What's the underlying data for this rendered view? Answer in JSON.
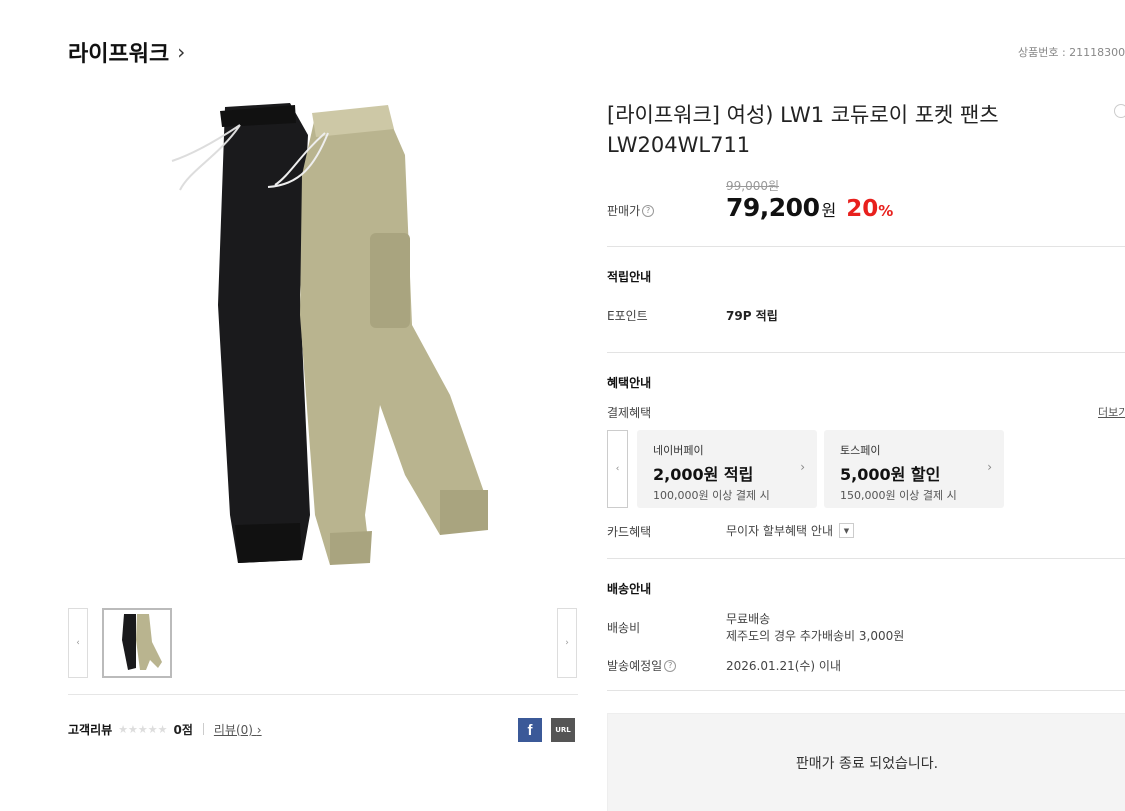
{
  "header": {
    "brand": "라이프워크",
    "brand_chevron": "›",
    "product_no": "상품번호 : 21118300"
  },
  "gallery": {
    "prev_label": "‹",
    "next_label": "›",
    "pants_colors": [
      "#1a1a1c",
      "#b9b48f"
    ]
  },
  "product": {
    "title": "[라이프워크] 여성) LW1 코듀로이 포켓 팬츠 LW204WL711",
    "original_price": "99,000원",
    "price_label": "판매가",
    "price": "79,200",
    "price_unit": "원",
    "discount": "20",
    "discount_unit": "%",
    "discount_color": "#e8201d"
  },
  "points": {
    "section_title": "적립안내",
    "label": "E포인트",
    "value": "79P 적립"
  },
  "benefits": {
    "section_title": "혜택안내",
    "payment_label": "결제혜택",
    "more_label": "더보기",
    "prev_label": "‹",
    "cards": [
      {
        "name": "네이버페이",
        "benefit": "2,000원 적립",
        "condition": "100,000원 이상 결제 시",
        "arrow": "›"
      },
      {
        "name": "토스페이",
        "benefit": "5,000원 할인",
        "condition": "150,000원 이상 결제 시",
        "arrow": "›"
      }
    ],
    "card_label": "카드혜택",
    "card_value": "무이자 할부혜택 안내",
    "card_dropdown": "▼"
  },
  "shipping": {
    "section_title": "배송안내",
    "fee_label": "배송비",
    "fee_value": "무료배송",
    "fee_note": "제주도의 경우 추가배송비 3,000원",
    "date_label": "발송예정일",
    "date_value": "2026.01.21(수) 이내"
  },
  "review": {
    "label": "고객리뷰",
    "stars": "★★★★★",
    "score": "0점",
    "link": "리뷰(0)",
    "link_chevron": "›"
  },
  "share": {
    "facebook": "f",
    "url": "URL"
  },
  "status": {
    "soldout": "판매가 종료 되었습니다."
  }
}
